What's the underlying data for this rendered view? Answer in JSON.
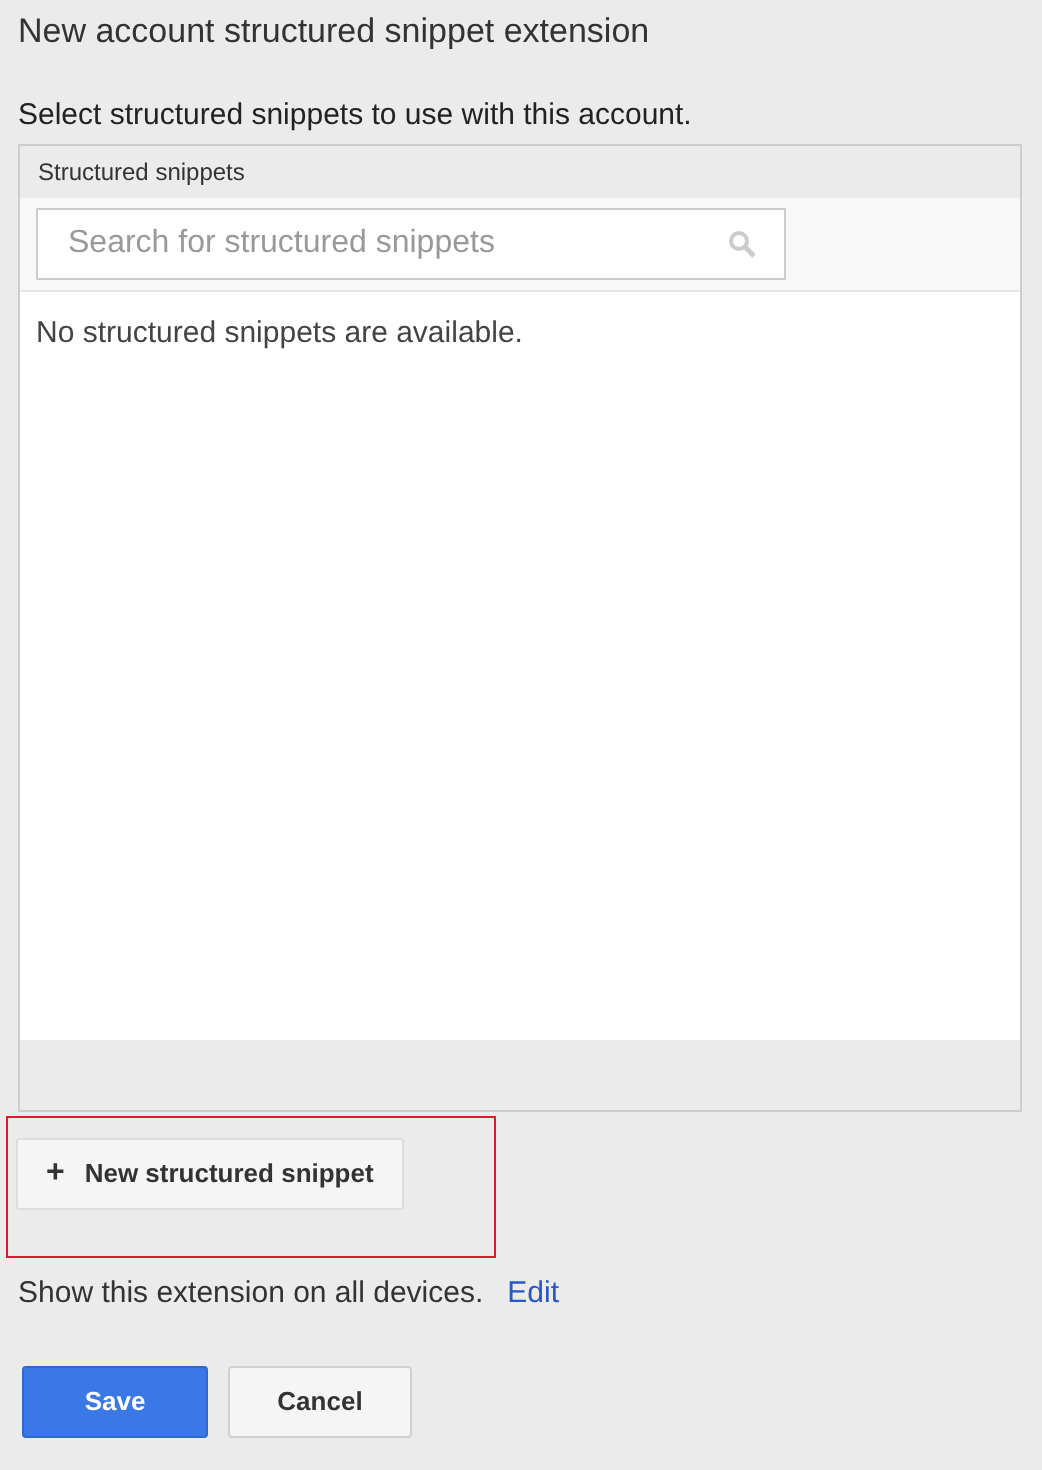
{
  "dialog": {
    "title": "New account structured snippet extension",
    "instruction": "Select structured snippets to use with this account."
  },
  "panel": {
    "header": "Structured snippets",
    "search": {
      "placeholder": "Search for structured snippets"
    },
    "empty_message": "No structured snippets are available."
  },
  "new_button": {
    "icon": "+",
    "label": "New structured snippet",
    "highlighted": true
  },
  "devices": {
    "text": "Show this extension on all devices.",
    "link": "Edit"
  },
  "buttons": [
    {
      "label": "Save",
      "kind": "primary"
    },
    {
      "label": "Cancel",
      "kind": "secondary"
    }
  ]
}
